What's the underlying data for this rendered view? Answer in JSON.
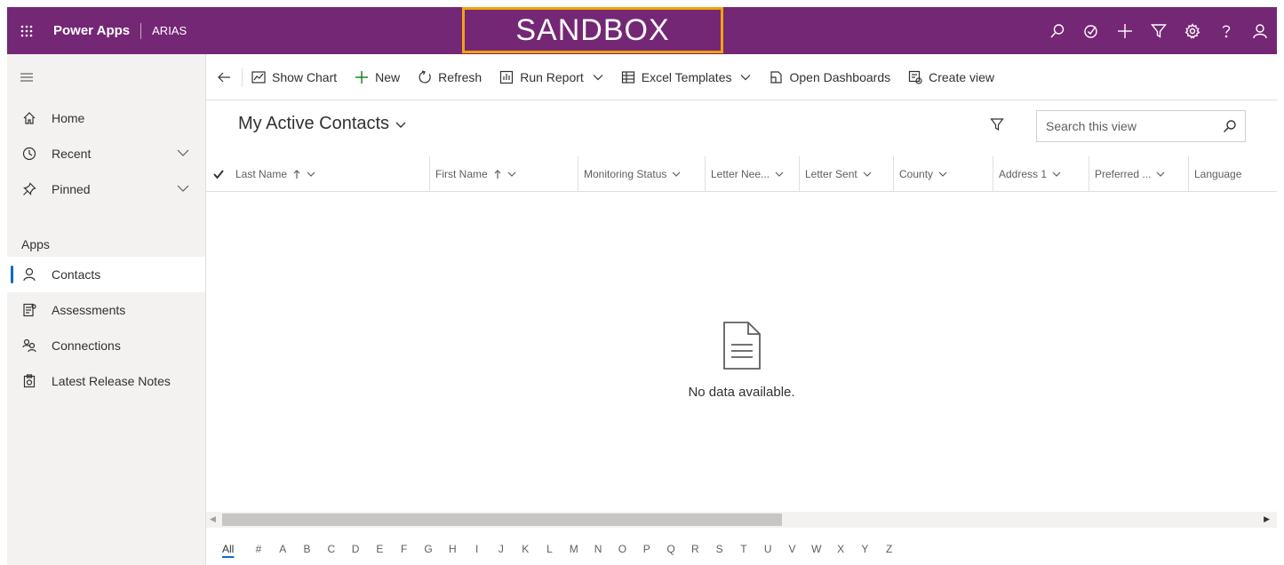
{
  "topbar": {
    "app_name": "Power Apps",
    "environment": "ARIAS",
    "banner": "SANDBOX",
    "banner_color": "#f0a30a",
    "bar_color": "#742774",
    "icons": [
      "search-icon",
      "task-icon",
      "plus-icon",
      "filter-icon",
      "settings-icon",
      "help-icon",
      "user-icon"
    ]
  },
  "sidebar": {
    "items": [
      {
        "label": "Home",
        "icon": "home-icon"
      },
      {
        "label": "Recent",
        "icon": "clock-icon"
      },
      {
        "label": "Pinned",
        "icon": "pin-icon"
      }
    ],
    "group_label": "Apps",
    "apps": [
      {
        "label": "Contacts",
        "icon": "person-icon",
        "active": true
      },
      {
        "label": "Assessments",
        "icon": "assessment-icon"
      },
      {
        "label": "Connections",
        "icon": "connections-icon"
      },
      {
        "label": "Latest Release Notes",
        "icon": "release-notes-icon"
      }
    ]
  },
  "commands": {
    "show_chart": "Show Chart",
    "new": "New",
    "refresh": "Refresh",
    "run_report": "Run Report",
    "excel_templates": "Excel Templates",
    "open_dashboards": "Open Dashboards",
    "create_view": "Create view"
  },
  "view": {
    "title": "My Active Contacts",
    "search_placeholder": "Search this view"
  },
  "grid": {
    "columns": [
      "Last Name",
      "First Name",
      "Monitoring Status",
      "Letter Nee...",
      "Letter Sent",
      "County",
      "Address 1",
      "Preferred ...",
      "Language"
    ],
    "empty_message": "No data available."
  },
  "jumpbar": {
    "letters": [
      "All",
      "#",
      "A",
      "B",
      "C",
      "D",
      "E",
      "F",
      "G",
      "H",
      "I",
      "J",
      "K",
      "L",
      "M",
      "N",
      "O",
      "P",
      "Q",
      "R",
      "S",
      "T",
      "U",
      "V",
      "W",
      "X",
      "Y",
      "Z"
    ],
    "active": "All"
  }
}
